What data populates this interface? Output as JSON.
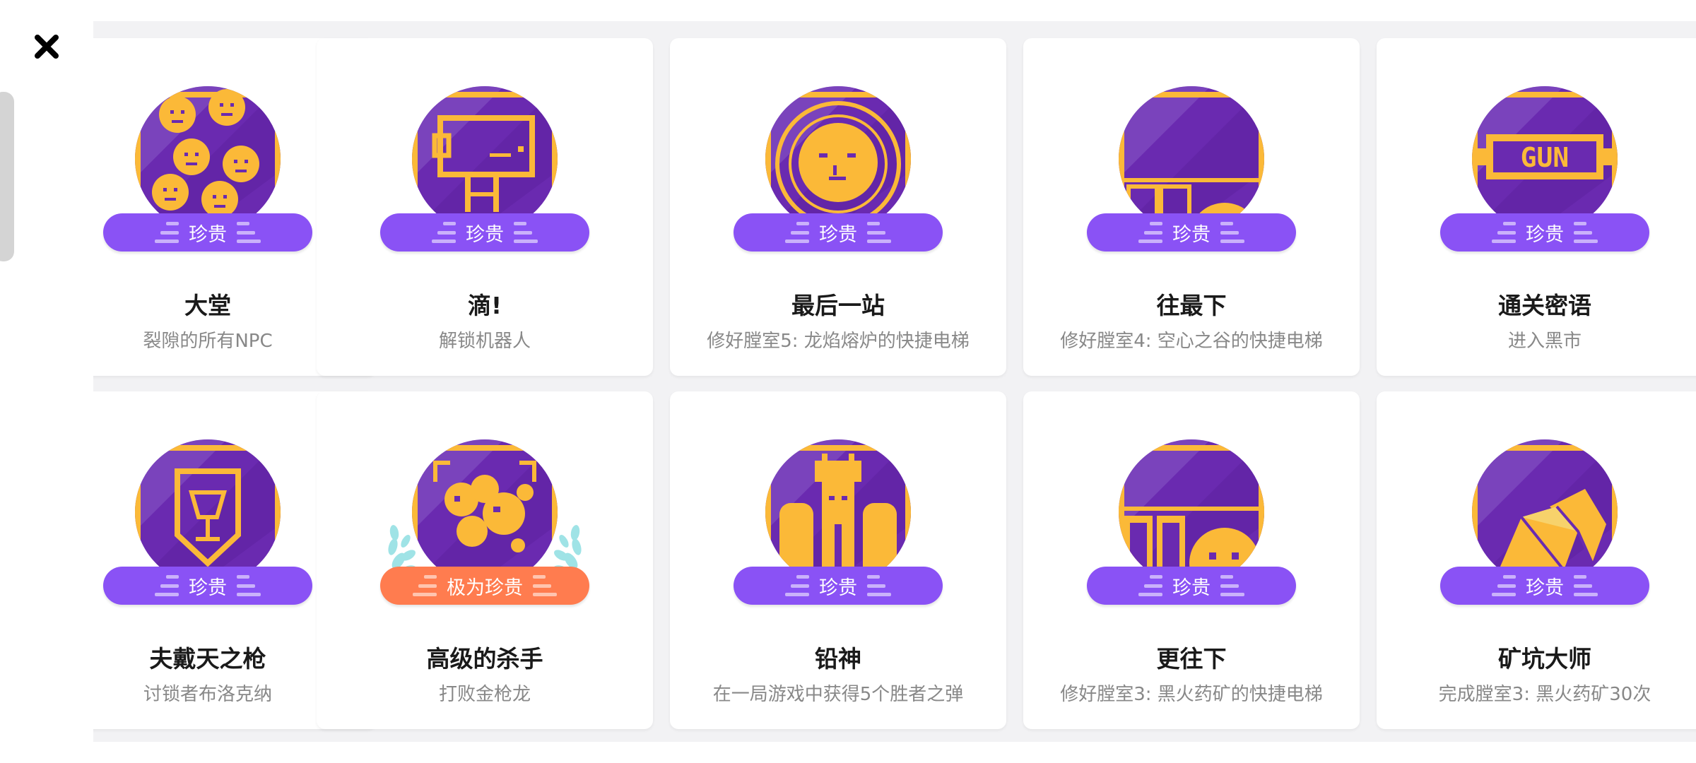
{
  "close_icon": "close-icon",
  "colors": {
    "rare": "#8a52f5",
    "epic": "#ff7c4f",
    "medal_bg": "#6a2ab0",
    "medal_gold": "#fbb938"
  },
  "rows": [
    [
      {
        "title": "大堂",
        "desc": "裂隙的所有NPC",
        "rarity": "珍贵",
        "tier": "rare",
        "icon": "npc-faces-icon"
      },
      {
        "title": "滴!",
        "desc": "解锁机器人",
        "rarity": "珍贵",
        "tier": "rare",
        "icon": "robot-icon"
      },
      {
        "title": "最后一站",
        "desc": "修好膛室5: 龙焰熔炉的快捷电梯",
        "rarity": "珍贵",
        "tier": "rare",
        "icon": "coin-face-icon"
      },
      {
        "title": "往最下",
        "desc": "修好膛室4: 空心之谷的快捷电梯",
        "rarity": "珍贵",
        "tier": "rare",
        "icon": "elevator-icon"
      },
      {
        "title": "通关密语",
        "desc": "进入黑市",
        "rarity": "珍贵",
        "tier": "rare",
        "icon": "gun-sign-icon"
      }
    ],
    [
      {
        "title": "夫戴天之枪",
        "desc": "讨锁者布洛克纳",
        "rarity": "珍贵",
        "tier": "rare",
        "icon": "goblet-shield-icon"
      },
      {
        "title": "高级的杀手",
        "desc": "打败金枪龙",
        "rarity": "极为珍贵",
        "tier": "epic",
        "icon": "dragon-icon"
      },
      {
        "title": "铅神",
        "desc": "在一局游戏中获得5个胜者之弹",
        "rarity": "珍贵",
        "tier": "rare",
        "icon": "lead-god-icon"
      },
      {
        "title": "更往下",
        "desc": "修好膛室3: 黑火药矿的快捷电梯",
        "rarity": "珍贵",
        "tier": "rare",
        "icon": "elevator-down-icon"
      },
      {
        "title": "矿坑大师",
        "desc": "完成膛室3: 黑火药矿30次",
        "rarity": "珍贵",
        "tier": "rare",
        "icon": "ore-rocks-icon"
      }
    ]
  ]
}
